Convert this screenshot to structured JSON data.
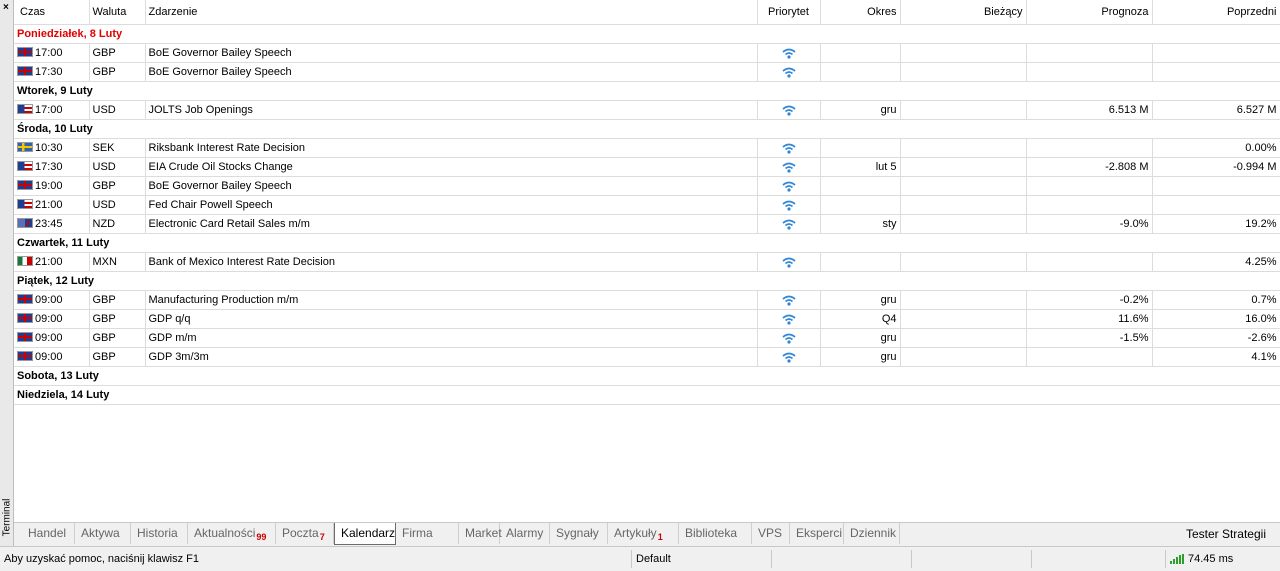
{
  "panel": {
    "close_label": "×",
    "side_label": "Terminal"
  },
  "columns": [
    "Czas",
    "Waluta",
    "Zdarzenie",
    "Priorytet",
    "Okres",
    "Bieżący",
    "Prognoza",
    "Poprzedni"
  ],
  "days": [
    {
      "label": "Poniedziałek, 8 Luty",
      "today": true,
      "events": [
        {
          "flag": "gb",
          "time": "17:00",
          "currency": "GBP",
          "event": "BoE Governor Bailey Speech",
          "period": "",
          "actual": "",
          "forecast": "",
          "previous": ""
        },
        {
          "flag": "gb",
          "time": "17:30",
          "currency": "GBP",
          "event": "BoE Governor Bailey Speech",
          "period": "",
          "actual": "",
          "forecast": "",
          "previous": ""
        }
      ]
    },
    {
      "label": "Wtorek, 9 Luty",
      "today": false,
      "events": [
        {
          "flag": "us",
          "time": "17:00",
          "currency": "USD",
          "event": "JOLTS Job Openings",
          "period": "gru",
          "actual": "",
          "forecast": "6.513 M",
          "previous": "6.527 M"
        }
      ]
    },
    {
      "label": "Środa, 10 Luty",
      "today": false,
      "events": [
        {
          "flag": "se",
          "time": "10:30",
          "currency": "SEK",
          "event": "Riksbank Interest Rate Decision",
          "period": "",
          "actual": "",
          "forecast": "",
          "previous": "0.00%"
        },
        {
          "flag": "us",
          "time": "17:30",
          "currency": "USD",
          "event": "EIA Crude Oil Stocks Change",
          "period": "lut 5",
          "actual": "",
          "forecast": "-2.808 M",
          "previous": "-0.994 M"
        },
        {
          "flag": "gb",
          "time": "19:00",
          "currency": "GBP",
          "event": "BoE Governor Bailey Speech",
          "period": "",
          "actual": "",
          "forecast": "",
          "previous": ""
        },
        {
          "flag": "us",
          "time": "21:00",
          "currency": "USD",
          "event": "Fed Chair Powell Speech",
          "period": "",
          "actual": "",
          "forecast": "",
          "previous": ""
        },
        {
          "flag": "nz",
          "time": "23:45",
          "currency": "NZD",
          "event": "Electronic Card Retail Sales m/m",
          "period": "sty",
          "actual": "",
          "forecast": "-9.0%",
          "previous": "19.2%"
        }
      ]
    },
    {
      "label": "Czwartek, 11 Luty",
      "today": false,
      "events": [
        {
          "flag": "mx",
          "time": "21:00",
          "currency": "MXN",
          "event": "Bank of Mexico Interest Rate Decision",
          "period": "",
          "actual": "",
          "forecast": "",
          "previous": "4.25%"
        }
      ]
    },
    {
      "label": "Piątek, 12 Luty",
      "today": false,
      "events": [
        {
          "flag": "gb",
          "time": "09:00",
          "currency": "GBP",
          "event": "Manufacturing Production m/m",
          "period": "gru",
          "actual": "",
          "forecast": "-0.2%",
          "previous": "0.7%"
        },
        {
          "flag": "gb",
          "time": "09:00",
          "currency": "GBP",
          "event": "GDP q/q",
          "period": "Q4",
          "actual": "",
          "forecast": "11.6%",
          "previous": "16.0%"
        },
        {
          "flag": "gb",
          "time": "09:00",
          "currency": "GBP",
          "event": "GDP m/m",
          "period": "gru",
          "actual": "",
          "forecast": "-1.5%",
          "previous": "-2.6%"
        },
        {
          "flag": "gb",
          "time": "09:00",
          "currency": "GBP",
          "event": "GDP 3m/3m",
          "period": "gru",
          "actual": "",
          "forecast": "",
          "previous": "4.1%"
        }
      ]
    },
    {
      "label": "Sobota, 13 Luty",
      "today": false,
      "events": []
    },
    {
      "label": "Niedziela, 14 Luty",
      "today": false,
      "events": []
    }
  ],
  "tabs": [
    {
      "label": "Handel",
      "badge": ""
    },
    {
      "label": "Aktywa",
      "badge": ""
    },
    {
      "label": "Historia",
      "badge": ""
    },
    {
      "label": "Aktualności",
      "badge": "99"
    },
    {
      "label": "Poczta",
      "badge": "7"
    },
    {
      "label": "Kalendarz",
      "badge": "",
      "active": true
    },
    {
      "label": "Firma",
      "badge": ""
    },
    {
      "label": "Market",
      "badge": ""
    },
    {
      "label": "Alarmy",
      "badge": ""
    },
    {
      "label": "Sygnały",
      "badge": ""
    },
    {
      "label": "Artykuły",
      "badge": "1"
    },
    {
      "label": "Biblioteka",
      "badge": ""
    },
    {
      "label": "VPS",
      "badge": ""
    },
    {
      "label": "Eksperci",
      "badge": ""
    },
    {
      "label": "Dziennik",
      "badge": ""
    }
  ],
  "tester_label": "Tester Strategii",
  "status": {
    "help": "Aby uzyskać pomoc, naciśnij klawisz F1",
    "profile": "Default",
    "ping": "74.45 ms"
  },
  "colors": {
    "today": "#e00000",
    "priority_icon": "#2f86d6",
    "badge": "#cc0000",
    "ping_bars": "#2aa02a"
  }
}
